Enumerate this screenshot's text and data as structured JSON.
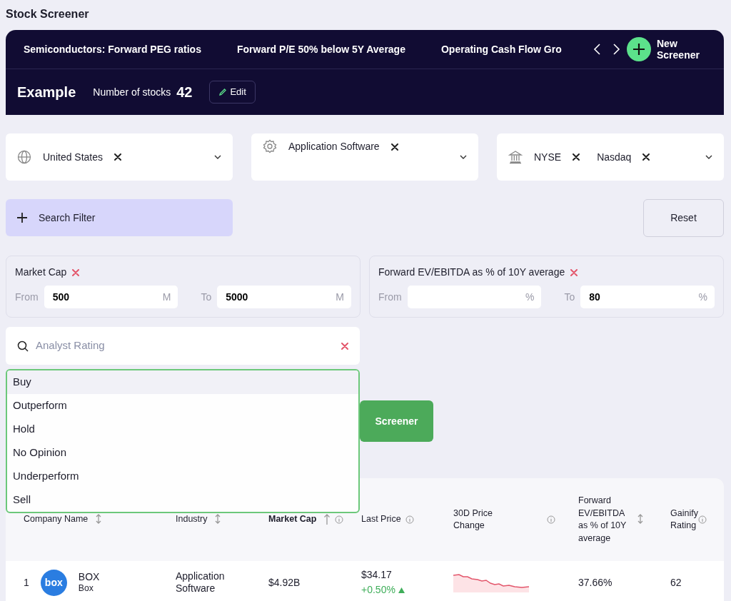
{
  "page_title": "Stock Screener",
  "screener_tabs": [
    {
      "label": "Semiconductors: Forward PEG ratios"
    },
    {
      "label": "Forward P/E 50% below 5Y Average"
    },
    {
      "label": "Operating Cash Flow Gro"
    }
  ],
  "new_screener_label": "New Screener",
  "screener": {
    "name": "Example",
    "count_label": "Number of stocks",
    "count": "42",
    "edit_label": "Edit"
  },
  "selectors": [
    {
      "kind": "globe",
      "chips": [
        "United States"
      ]
    },
    {
      "kind": "gear",
      "chips": [
        "Application Software"
      ]
    },
    {
      "kind": "bank",
      "chips": [
        "NYSE",
        "Nasdaq"
      ]
    }
  ],
  "search_filter_label": "Search Filter",
  "reset_label": "Reset",
  "range_filters": [
    {
      "label": "Market Cap",
      "from_label": "From",
      "from_value": "500",
      "from_unit": "M",
      "to_label": "To",
      "to_value": "5000",
      "to_unit": "M"
    },
    {
      "label": "Forward EV/EBITDA as % of 10Y average",
      "from_label": "From",
      "from_unit": "%",
      "to_label": "To",
      "to_value": "80",
      "to_unit": "%"
    }
  ],
  "analyst_search": {
    "placeholder": "Analyst Rating",
    "options": [
      {
        "label": "Buy",
        "highlighted": true
      },
      {
        "label": "Outperform",
        "highlighted": false
      },
      {
        "label": "Hold",
        "highlighted": false
      },
      {
        "label": "No Opinion",
        "highlighted": false
      },
      {
        "label": "Underperform",
        "highlighted": false
      },
      {
        "label": "Sell",
        "highlighted": false
      }
    ]
  },
  "apply_button_label": "Screener",
  "table": {
    "columns": [
      {
        "label": "Company Name",
        "sortable": true,
        "sorted": false,
        "info": false
      },
      {
        "label": "Industry",
        "sortable": true,
        "sorted": false,
        "info": false
      },
      {
        "label": "Market Cap",
        "sortable": true,
        "sorted": true,
        "info": true
      },
      {
        "label": "Last Price",
        "sortable": false,
        "sorted": false,
        "info": true
      },
      {
        "label": "30D Price Change",
        "sortable": false,
        "sorted": false,
        "info": true
      },
      {
        "label": "Forward EV/EBITDA as % of 10Y average",
        "sortable": true,
        "sorted": false,
        "info": false
      },
      {
        "label": "Gainify Rating",
        "sortable": false,
        "sorted": false,
        "info": true
      }
    ],
    "rows": [
      {
        "rank": "1",
        "logo_text": "box",
        "ticker": "BOX",
        "name": "Box",
        "industry": "Application Software",
        "market_cap": "$4.92B",
        "last_price": "$34.17",
        "change": "+0.50%",
        "rising": true,
        "fwd": "37.66%",
        "rating": "62"
      }
    ]
  }
}
